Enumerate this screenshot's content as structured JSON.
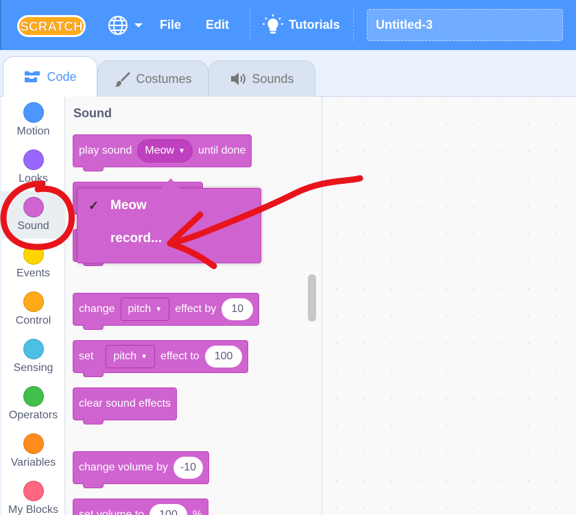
{
  "menubar": {
    "logo_text": "SCRATCH",
    "file_label": "File",
    "edit_label": "Edit",
    "tutorials_label": "Tutorials",
    "project_title": "Untitled-3"
  },
  "tabs": [
    {
      "label": "Code"
    },
    {
      "label": "Costumes"
    },
    {
      "label": "Sounds"
    }
  ],
  "categories": [
    {
      "label": "Motion",
      "color": "#4c97ff"
    },
    {
      "label": "Looks",
      "color": "#9966ff"
    },
    {
      "label": "Sound",
      "color": "#cf63cf"
    },
    {
      "label": "Events",
      "color": "#ffd500"
    },
    {
      "label": "Control",
      "color": "#ffab19"
    },
    {
      "label": "Sensing",
      "color": "#4cbfe6"
    },
    {
      "label": "Operators",
      "color": "#40bf4a"
    },
    {
      "label": "Variables",
      "color": "#ff8c1a"
    },
    {
      "label": "My Blocks",
      "color": "#ff6680"
    }
  ],
  "palette": {
    "section_title": "Sound",
    "play_sound": {
      "text": "play sound",
      "sound": "Meow",
      "suffix": "until done"
    },
    "change_effect": {
      "text": "change",
      "effect": "pitch",
      "middle": "effect by",
      "value": "10"
    },
    "set_effect": {
      "text": "set",
      "effect": "pitch",
      "middle": "effect to",
      "value": "100"
    },
    "clear_effects": {
      "text": "clear sound effects"
    },
    "change_volume": {
      "text": "change volume by",
      "value": "-10"
    },
    "set_volume": {
      "text": "set volume to",
      "value": "100",
      "suffix": "%"
    }
  },
  "dropdown": {
    "options": [
      {
        "label": "Meow",
        "checked": true
      },
      {
        "label": "record..."
      }
    ],
    "check_mark": "✓"
  },
  "annotation_color": "#e8141b"
}
